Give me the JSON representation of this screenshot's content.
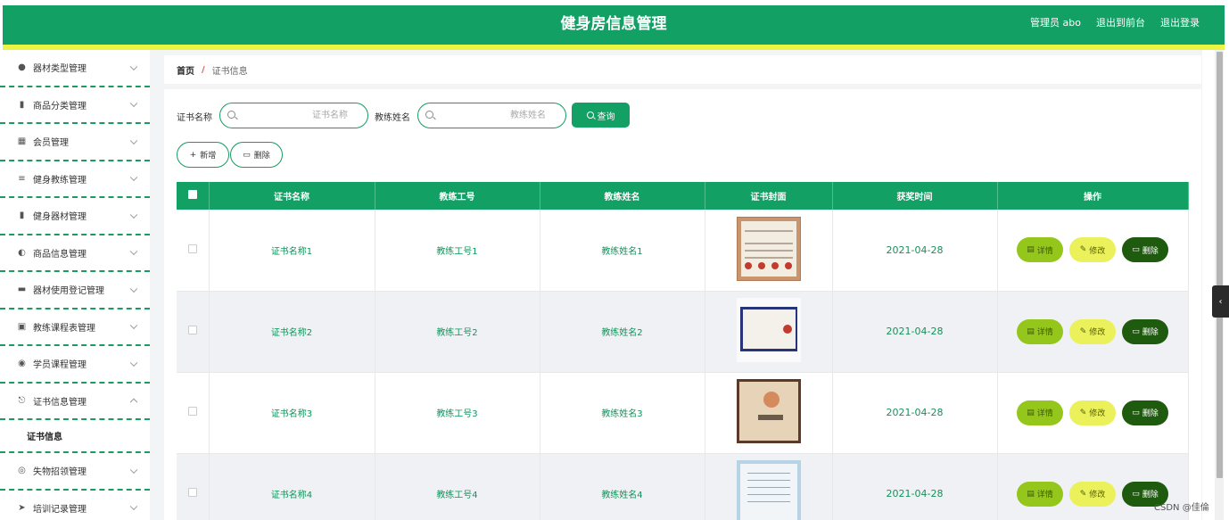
{
  "header": {
    "title": "健身房信息管理",
    "user": "管理员 abo",
    "to_front": "退出到前台",
    "logout": "退出登录"
  },
  "sidebar": {
    "items": [
      {
        "label": "器材类型管理",
        "icon": "user-icon"
      },
      {
        "label": "商品分类管理",
        "icon": "clipboard-icon"
      },
      {
        "label": "会员管理",
        "icon": "grid-icon"
      },
      {
        "label": "健身教练管理",
        "icon": "list-icon"
      },
      {
        "label": "健身器材管理",
        "icon": "clipboard-icon"
      },
      {
        "label": "商品信息管理",
        "icon": "gauge-icon"
      },
      {
        "label": "器材使用登记管理",
        "icon": "ticket-icon"
      },
      {
        "label": "教练课程表管理",
        "icon": "calendar-icon"
      },
      {
        "label": "学员课程管理",
        "icon": "location-icon"
      },
      {
        "label": "证书信息管理",
        "icon": "power-icon"
      },
      {
        "label": "失物招领管理",
        "icon": "globe-icon"
      },
      {
        "label": "培训记录管理",
        "icon": "send-icon"
      }
    ],
    "sub_item": "证书信息"
  },
  "breadcrumb": {
    "home": "首页",
    "separator": "/",
    "current": "证书信息"
  },
  "search": {
    "cert_label": "证书名称",
    "cert_placeholder": "证书名称",
    "coach_label": "教练姓名",
    "coach_placeholder": "教练姓名",
    "query": "查询"
  },
  "actions": {
    "add": "新增",
    "delete": "删除"
  },
  "table": {
    "columns": [
      "证书名称",
      "教练工号",
      "教练姓名",
      "证书封面",
      "获奖时间",
      "操作"
    ],
    "rows": [
      {
        "name": "证书名称1",
        "no": "教练工号1",
        "coach": "教练姓名1",
        "date": "2021-04-28"
      },
      {
        "name": "证书名称2",
        "no": "教练工号2",
        "coach": "教练姓名2",
        "date": "2021-04-28"
      },
      {
        "name": "证书名称3",
        "no": "教练工号3",
        "coach": "教练姓名3",
        "date": "2021-04-28"
      },
      {
        "name": "证书名称4",
        "no": "教练工号4",
        "coach": "教练姓名4",
        "date": "2021-04-28"
      }
    ],
    "btn_detail": "详情",
    "btn_edit": "修改",
    "btn_delete": "删除"
  },
  "watermark": "CSDN @佳倫",
  "colors": {
    "primary": "#12a064",
    "accent_bar": "#e9f542",
    "detail": "#95c61c",
    "edit": "#eaf15b",
    "delete": "#1f5b0f"
  }
}
